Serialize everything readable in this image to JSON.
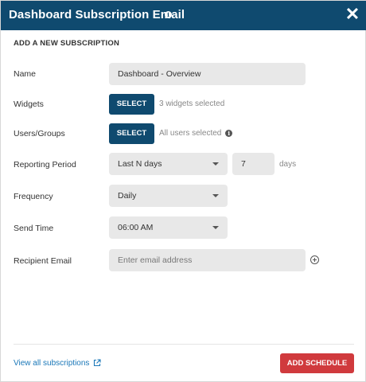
{
  "dialog": {
    "title": "Dashboard Subscription Email",
    "title_info_icon": "info-icon",
    "close_icon": "close-icon",
    "title_bar_color": "#0f4a6f"
  },
  "section": {
    "heading": "ADD A NEW SUBSCRIPTION"
  },
  "form": {
    "name": {
      "label": "Name",
      "value": "Dashboard - Overview"
    },
    "widgets": {
      "label": "Widgets",
      "button": "SELECT",
      "helper": "3 widgets selected"
    },
    "users_groups": {
      "label": "Users/Groups",
      "button": "SELECT",
      "helper": "All users selected"
    },
    "reporting_period": {
      "label": "Reporting Period",
      "selected": "Last N days",
      "count": "7",
      "unit": "days"
    },
    "frequency": {
      "label": "Frequency",
      "selected": "Daily"
    },
    "send_time": {
      "label": "Send Time",
      "selected": "06:00 AM"
    },
    "recipient_email": {
      "label": "Recipient Email",
      "placeholder": "Enter email address"
    }
  },
  "footer": {
    "view_all_link": "View all subscriptions",
    "add_button": "ADD SCHEDULE",
    "add_button_color": "#d03a3d",
    "link_color": "#1a77b8"
  }
}
